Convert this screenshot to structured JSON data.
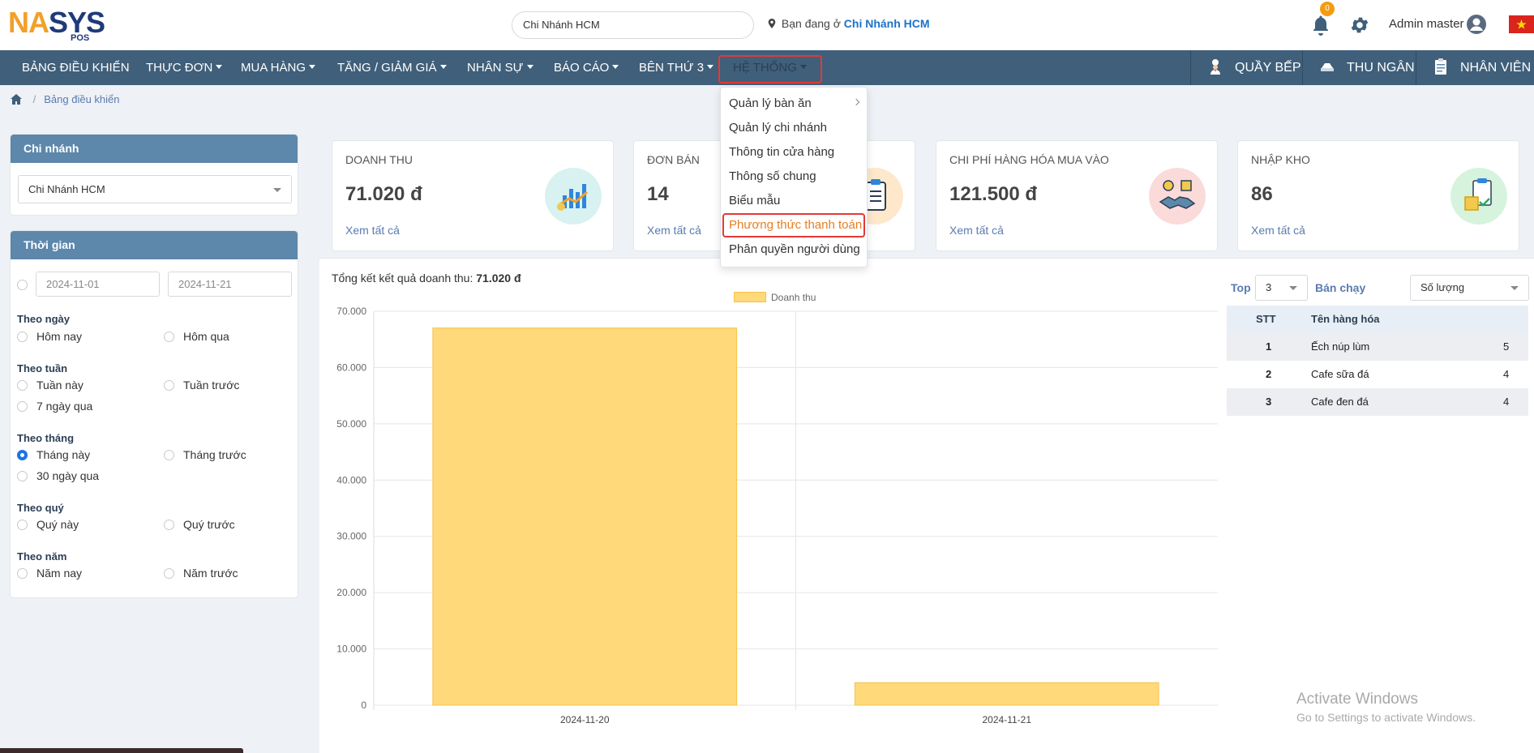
{
  "header": {
    "logo_text_na": "NA",
    "logo_text_s": "S",
    "logo_text_ys": "YS",
    "logo_sub": "POS",
    "branch_select": "Chi Nhánh HCM",
    "location_prefix": "Bạn đang ở",
    "location_branch": "Chi Nhánh HCM",
    "notification_count": "0",
    "user_name": "Admin master"
  },
  "nav": {
    "items": [
      "BẢNG ĐIỀU KHIỂN",
      "THỰC ĐƠN",
      "MUA HÀNG",
      "TĂNG / GIẢM GIÁ",
      "NHÂN SỰ",
      "BÁO CÁO",
      "BÊN THỨ 3",
      "HỆ THỐNG"
    ],
    "right": [
      "QUẦY BẾP",
      "THU NGÂN",
      "NHÂN VIÊN"
    ]
  },
  "menu": {
    "items": [
      "Quản lý bàn ăn",
      "Quản lý chi nhánh",
      "Thông tin cửa hàng",
      "Thông số chung",
      "Biểu mẫu",
      "Phương thức thanh toán",
      "Phân quyền người dùng"
    ]
  },
  "breadcrumb": {
    "current": "Bảng điều khiển"
  },
  "branch_panel": {
    "title": "Chi nhánh",
    "selected": "Chi Nhánh HCM"
  },
  "time_panel": {
    "title": "Thời gian",
    "from": "2024-11-01",
    "to": "2024-11-21",
    "groups": {
      "day": {
        "label": "Theo ngày",
        "opt1": "Hôm nay",
        "opt2": "Hôm qua"
      },
      "week": {
        "label": "Theo tuần",
        "opt1": "Tuần này",
        "opt2": "Tuần trước",
        "opt3": "7 ngày qua"
      },
      "month": {
        "label": "Theo tháng",
        "opt1": "Tháng này",
        "opt2": "Tháng trước",
        "opt3": "30 ngày qua"
      },
      "quarter": {
        "label": "Theo quý",
        "opt1": "Quý này",
        "opt2": "Quý trước"
      },
      "year": {
        "label": "Theo năm",
        "opt1": "Năm nay",
        "opt2": "Năm trước"
      }
    }
  },
  "stats": [
    {
      "title": "DOANH THU",
      "value": "71.020 đ",
      "link": "Xem tất cả"
    },
    {
      "title": "ĐƠN BÁN",
      "value": "14",
      "link": "Xem tất cả"
    },
    {
      "title": "CHI PHÍ HÀNG HÓA MUA VÀO",
      "value": "121.500 đ",
      "link": "Xem tất cả"
    },
    {
      "title": "NHẬP KHO",
      "value": "86",
      "link": "Xem tất cả"
    }
  ],
  "revenue": {
    "summary_label": "Tổng kết kết quả doanh thu:",
    "summary_value": "71.020 đ"
  },
  "chart_data": {
    "type": "bar",
    "categories": [
      "2024-11-20",
      "2024-11-21"
    ],
    "series": [
      {
        "name": "Doanh thu",
        "values": [
          67020,
          4000
        ]
      }
    ],
    "ylim": [
      0,
      70000
    ],
    "yticks": [
      "0",
      "10.000",
      "20.000",
      "30.000",
      "40.000",
      "50.000",
      "60.000",
      "70.000"
    ],
    "legend": "top",
    "grid": true,
    "bar_color": "#ffd97a"
  },
  "top_products": {
    "top_label": "Top",
    "top_value": "3",
    "best_label": "Bán chạy",
    "sort_value": "Số lượng",
    "headers": [
      "STT",
      "Tên hàng hóa"
    ],
    "rows": [
      {
        "stt": "1",
        "name": "Ếch núp lùm",
        "qty": "5"
      },
      {
        "stt": "2",
        "name": "Cafe sữa đá",
        "qty": "4"
      },
      {
        "stt": "3",
        "name": "Cafe đen đá",
        "qty": "4"
      }
    ]
  },
  "watermark": {
    "line1": "Activate Windows",
    "line2": "Go to Settings to activate Windows."
  }
}
